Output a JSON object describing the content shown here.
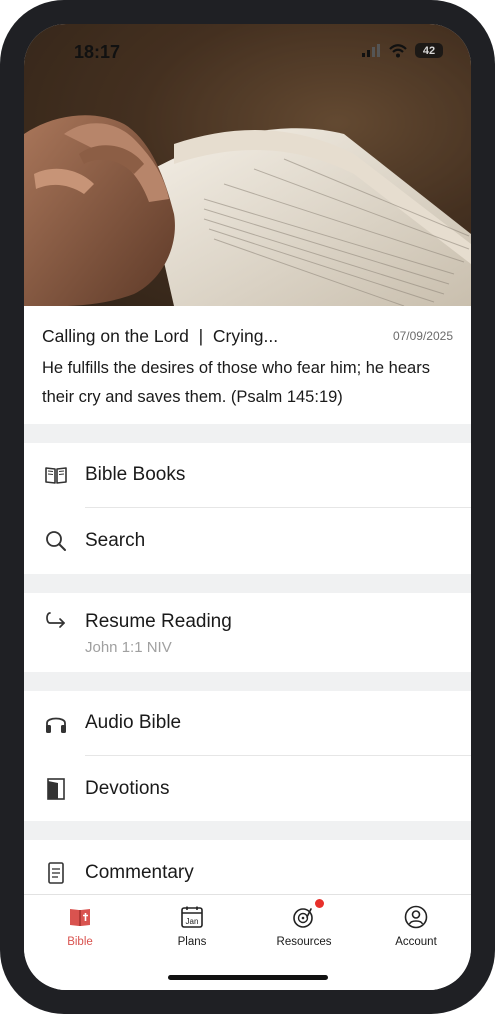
{
  "status_bar": {
    "time": "18:17",
    "battery": "42"
  },
  "verse": {
    "title": "Calling on the Lord  |  Crying...",
    "date": "07/09/2025",
    "text": "He fulfills the desires of those who fear him; he hears their cry and saves them. (Psalm 145:19)"
  },
  "menu": {
    "bible_books": "Bible Books",
    "search": "Search",
    "resume_reading": "Resume Reading",
    "resume_sub": "John 1:1 NIV",
    "audio_bible": "Audio Bible",
    "devotions": "Devotions",
    "commentary": "Commentary"
  },
  "tabs": [
    {
      "label": "Bible",
      "icon": "bible-icon",
      "active": true
    },
    {
      "label": "Plans",
      "icon": "calendar-icon",
      "active": false
    },
    {
      "label": "Resources",
      "icon": "record-player-icon",
      "active": false,
      "badge": true
    },
    {
      "label": "Account",
      "icon": "user-icon",
      "active": false
    }
  ],
  "colors": {
    "accent": "#d9534f",
    "separator": "#f0f1f2",
    "tab_bar_bg": "#ffffff"
  },
  "icons": {
    "calendar_text": "Jan"
  }
}
